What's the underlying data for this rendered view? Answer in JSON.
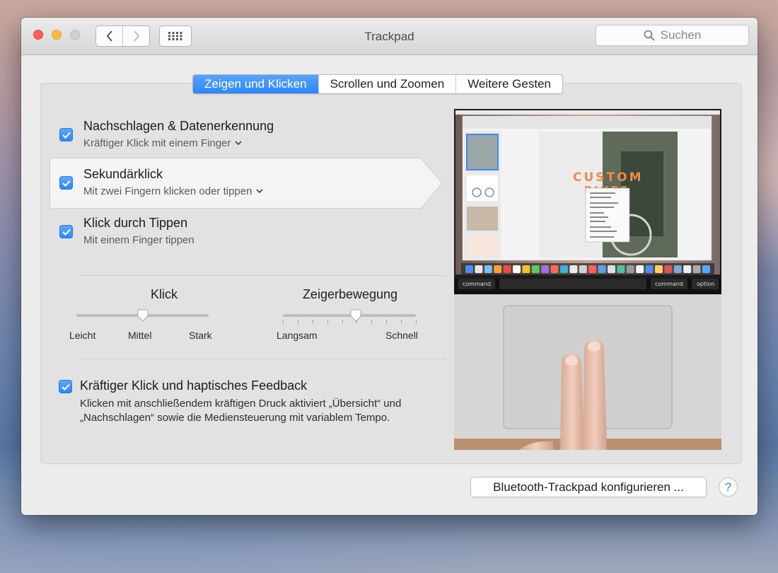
{
  "window": {
    "title": "Trackpad"
  },
  "search": {
    "placeholder": "Suchen"
  },
  "tabs": [
    {
      "label": "Zeigen und Klicken",
      "active": true
    },
    {
      "label": "Scrollen und Zoomen",
      "active": false
    },
    {
      "label": "Weitere Gesten",
      "active": false
    }
  ],
  "options": [
    {
      "title": "Nachschlagen & Datenerkennung",
      "subtitle": "Kräftiger Klick mit einem Finger",
      "checked": true,
      "has_menu": true
    },
    {
      "title": "Sekundärklick",
      "subtitle": "Mit zwei Fingern klicken oder tippen",
      "checked": true,
      "has_menu": true,
      "selected": true
    },
    {
      "title": "Klick durch Tippen",
      "subtitle": "Mit einem Finger tippen",
      "checked": true,
      "has_menu": false
    }
  ],
  "click_slider": {
    "title": "Klick",
    "labels": [
      "Leicht",
      "Mittel",
      "Stark"
    ],
    "value": 0.5
  },
  "pointer_slider": {
    "title": "Zeigerbewegung",
    "min_label": "Langsam",
    "max_label": "Schnell",
    "value": 0.55
  },
  "force_click": {
    "title": "Kräftiger Klick und haptisches Feedback",
    "checked": true,
    "description": "Klicken mit anschließendem kräftigen Druck aktiviert „Übersicht“ und „Nachschlagen“ sowie die Mediensteuerung mit variablem Tempo."
  },
  "preview": {
    "slide_text": "CUSTOM BIKES",
    "key_left": "command",
    "key_right": "command",
    "key_option": "option"
  },
  "footer": {
    "bluetooth_button": "Bluetooth-Trackpad konfigurieren ...",
    "help_label": "?"
  },
  "colors": {
    "accent": "#2d86f7"
  },
  "icons": [
    "back-icon",
    "forward-icon",
    "grid-icon",
    "search-icon",
    "checkmark-icon",
    "chevron-down-icon",
    "help-icon"
  ]
}
